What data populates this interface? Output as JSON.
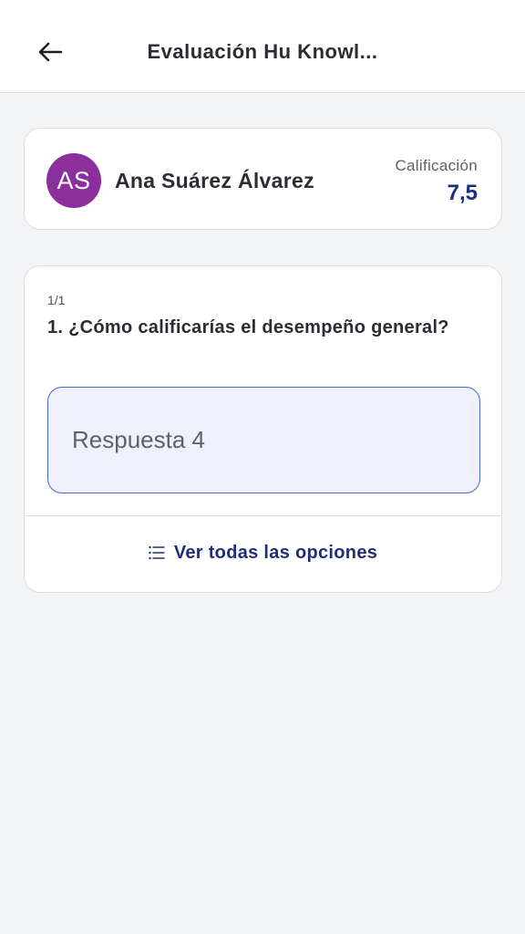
{
  "header": {
    "title": "Evaluación Hu Knowl...",
    "back_icon": "arrow-left-icon"
  },
  "student": {
    "initials": "AS",
    "name": "Ana Suárez Álvarez",
    "grade_label": "Calificación",
    "grade_value": "7,5",
    "avatar_color": "#8a2f9c"
  },
  "question": {
    "counter": "1/1",
    "text": "1. ¿Cómo calificarías el desempeño general?",
    "answer": "Respuesta 4",
    "view_all_label": "Ver todas las opciones",
    "view_all_icon": "list-icon"
  },
  "colors": {
    "accent": "#1f2e7a",
    "answer_border": "#4a62cf",
    "answer_bg": "#eef1fc"
  }
}
